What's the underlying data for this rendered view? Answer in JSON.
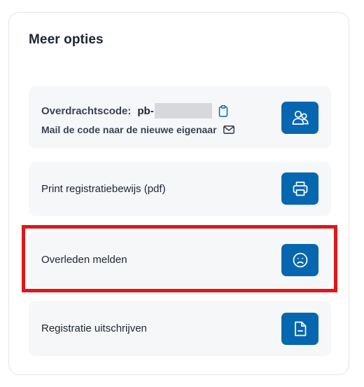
{
  "panel": {
    "title": "Meer opties"
  },
  "cards": {
    "transfer": {
      "code_label": "Overdrachtscode:",
      "code_prefix": "pb-",
      "mail_label": "Mail de code naar de nieuwe eigenaar",
      "button_icon": "users-icon"
    },
    "print": {
      "label": "Print registratiebewijs (pdf)",
      "button_icon": "printer-icon"
    },
    "deceased": {
      "label": "Overleden melden",
      "button_icon": "sad-face-icon"
    },
    "deregister": {
      "label": "Registratie uitschrijven",
      "button_icon": "document-minus-icon"
    }
  },
  "colors": {
    "primary": "#0667b0",
    "card_background": "#f6f7f9",
    "highlight": "#e3151a",
    "text": "#1d2433"
  }
}
